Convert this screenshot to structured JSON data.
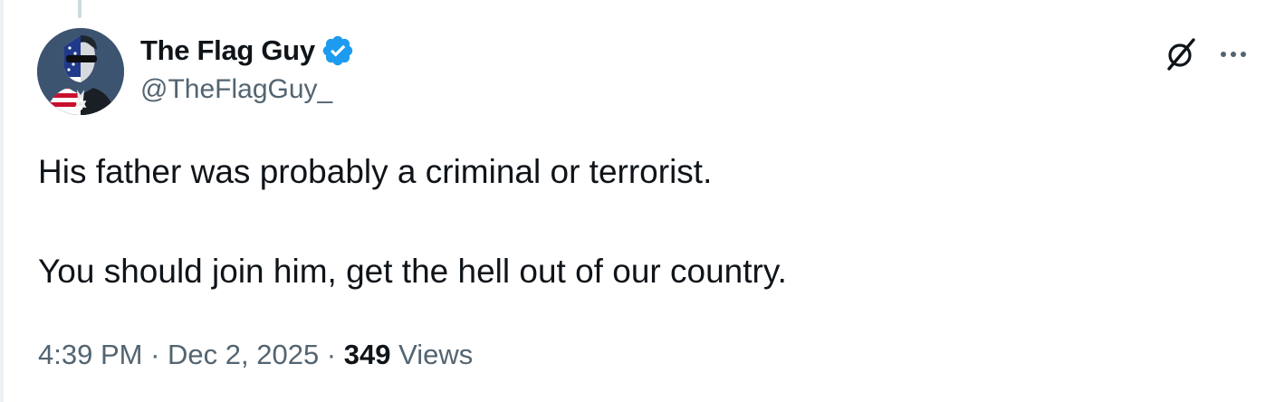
{
  "tweet": {
    "author": {
      "display_name": "The Flag Guy",
      "handle": "@TheFlagGuy_",
      "verified_badge_icon": "verified-check-icon",
      "avatar_icon": "avatar-flag-man"
    },
    "top_actions": {
      "grok_icon": "grok-slash-icon",
      "more_icon": "more-dots-icon"
    },
    "text": {
      "line1": "His father was probably a criminal or terrorist.",
      "line2": "You should join him, get the hell out of our country."
    },
    "meta": {
      "time": "4:39 PM",
      "separator1": " · ",
      "date": "Dec 2, 2025",
      "separator2": " · ",
      "views_count": "349",
      "views_label": " Views"
    }
  },
  "colors": {
    "primary_text": "#0f1419",
    "secondary_text": "#536471",
    "verified_blue": "#1d9bf0",
    "background": "#ffffff"
  }
}
